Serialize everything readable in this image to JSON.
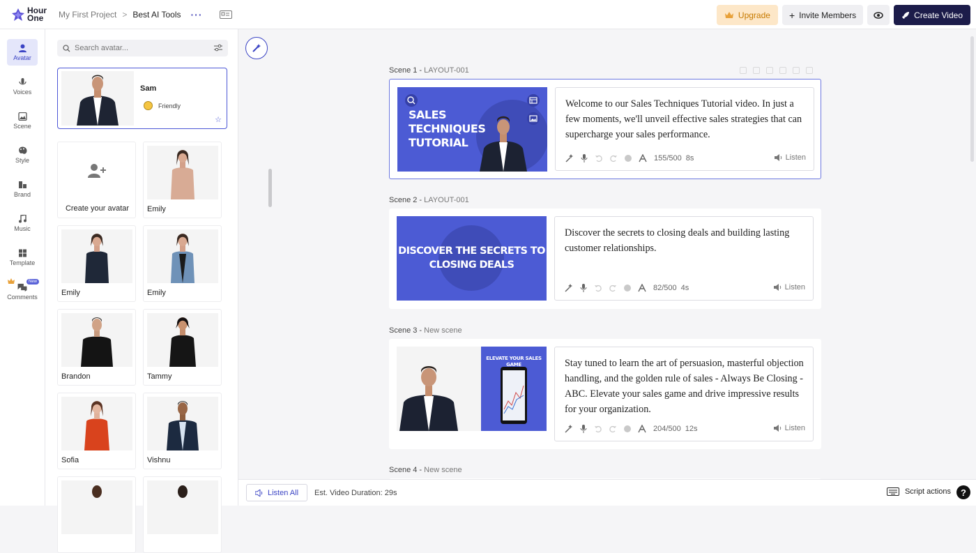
{
  "header": {
    "logo_line1": "Hour",
    "logo_line2": "One",
    "breadcrumb": [
      "My First Project",
      "Best AI Tools"
    ],
    "breadcrumb_sep": ">",
    "more": "···",
    "upgrade_label": "Upgrade",
    "invite_label": "Invite Members",
    "create_label": "Create Video",
    "colors": {
      "brand": "#3b44c4",
      "upgrade_bg": "#fde7c8",
      "upgrade_text": "#c77a00",
      "create_bg": "#1c1c4a"
    }
  },
  "sidebar": {
    "items": [
      {
        "label": "Avatar",
        "icon": "person-icon",
        "active": true
      },
      {
        "label": "Voices",
        "icon": "microphone-icon"
      },
      {
        "label": "Scene",
        "icon": "image-icon"
      },
      {
        "label": "Style",
        "icon": "palette-icon"
      },
      {
        "label": "Brand",
        "icon": "brand-icon"
      },
      {
        "label": "Music",
        "icon": "music-note-icon"
      },
      {
        "label": "Template",
        "icon": "template-grid-icon"
      },
      {
        "label": "Comments",
        "icon": "comments-icon",
        "badge": "New"
      }
    ]
  },
  "avatar_panel": {
    "search_placeholder": "Search avatar...",
    "selected": {
      "name": "Sam",
      "mood": "Friendly"
    },
    "create_label": "Create your avatar",
    "avatars": [
      "Emily",
      "Emily",
      "Emily",
      "Brandon",
      "Tammy",
      "Sofia",
      "Vishnu"
    ]
  },
  "scenes": [
    {
      "label": "Scene 1 -",
      "layout": "LAYOUT-001",
      "slide_text": [
        "Sales",
        "Techniques",
        "Tutorial"
      ],
      "script": "Welcome to our Sales Techniques Tutorial video. In just a few moments, we'll unveil effective sales strategies that can supercharge your sales performance.",
      "count": "155/500",
      "duration": "8s",
      "listen": "Listen"
    },
    {
      "label": "Scene 2 -",
      "layout": "LAYOUT-001",
      "slide_text": [
        "Discover the secrets to",
        "closing deals"
      ],
      "script": "Discover the secrets to closing deals and building lasting customer relationships.",
      "count": "82/500",
      "duration": "4s",
      "listen": "Listen"
    },
    {
      "label": "Scene 3 -",
      "layout": "New scene",
      "slide_text": [
        "Elevate your sales game"
      ],
      "script": "Stay tuned to learn the art of persuasion, masterful objection handling, and the golden rule of sales - Always Be Closing - ABC. Elevate your sales game and drive impressive results for your organization.",
      "count": "204/500",
      "duration": "12s",
      "listen": "Listen"
    },
    {
      "label": "Scene 4 -",
      "layout": "New scene"
    }
  ],
  "footer": {
    "listen_all": "Listen All",
    "est_duration": "Est. Video Duration: 29s",
    "script_actions": "Script actions",
    "help": "?"
  }
}
